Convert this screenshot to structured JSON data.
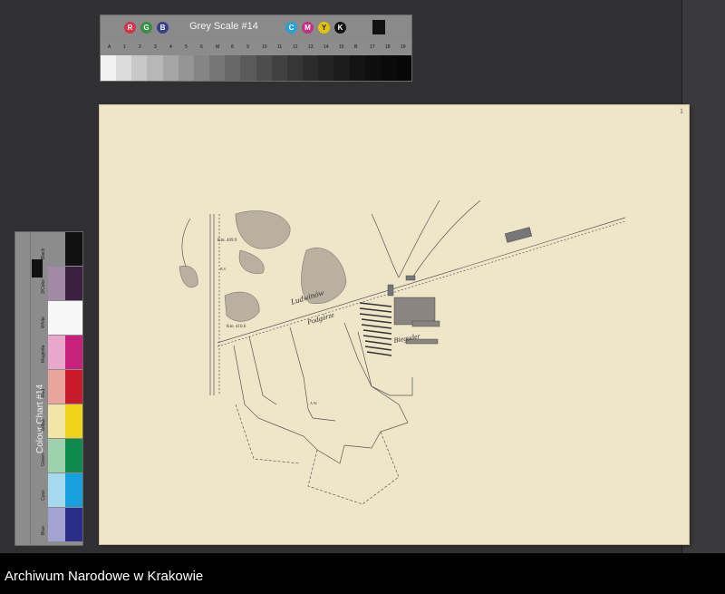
{
  "grey_scale": {
    "title": "Grey Scale #14",
    "rgb_dots": [
      {
        "letter": "R",
        "color": "#d4334a"
      },
      {
        "letter": "G",
        "color": "#3a8d44"
      },
      {
        "letter": "B",
        "color": "#3a3f8c"
      }
    ],
    "cmyk_dots": [
      {
        "letter": "C",
        "color": "#2a9fd8"
      },
      {
        "letter": "M",
        "color": "#c4307f"
      },
      {
        "letter": "Y",
        "color": "#e0c400"
      },
      {
        "letter": "K",
        "color": "#111111"
      }
    ],
    "ticks": [
      "A",
      "1",
      "2",
      "3",
      "4",
      "5",
      "6",
      "M",
      "8",
      "9",
      "10",
      "11",
      "12",
      "13",
      "14",
      "15",
      "B",
      "17",
      "18",
      "19"
    ],
    "patch_colors": [
      "#f2f2f2",
      "#dcdcdc",
      "#c8c8c8",
      "#b7b7b7",
      "#a6a6a6",
      "#959595",
      "#858585",
      "#767676",
      "#686868",
      "#5a5a5a",
      "#4d4d4d",
      "#414141",
      "#363636",
      "#2c2c2c",
      "#232323",
      "#1b1b1b",
      "#141414",
      "#0e0e0e",
      "#0a0a0a",
      "#070707"
    ]
  },
  "colour_chart": {
    "title": "Colour Chart #14",
    "patches": [
      {
        "label": "Black",
        "left": "#8c8c8c",
        "right": "#111111"
      },
      {
        "label": "3/Color",
        "left": "#a08aa6",
        "right": "#3d1f42"
      },
      {
        "label": "White",
        "left": "#f7f7f7",
        "right": "#f7f7f7"
      },
      {
        "label": "Magenta",
        "left": "#e9a7cb",
        "right": "#c7217c"
      },
      {
        "label": "Red",
        "left": "#e8a59c",
        "right": "#c81a2b"
      },
      {
        "label": "Yellow",
        "left": "#f1e6a6",
        "right": "#efd51a"
      },
      {
        "label": "Green",
        "left": "#9fd1ac",
        "right": "#0f8a4e"
      },
      {
        "label": "Cyan",
        "left": "#a6d8ee",
        "right": "#17a0dc"
      },
      {
        "label": "Blue",
        "left": "#a3a3d2",
        "right": "#2a2e86"
      }
    ]
  },
  "map": {
    "labels": {
      "km_top": "Km. 409.9",
      "km_bottom": "Km. 410.6",
      "road_name": "Podgórze",
      "estate_name": "Ludwinów",
      "brickworks": "Bieguder",
      "field_mark": "A.W.",
      "bs": "B.S.",
      "corner": "1"
    }
  },
  "footer": {
    "archive": "Archiwum Narodowe w Krakowie"
  }
}
